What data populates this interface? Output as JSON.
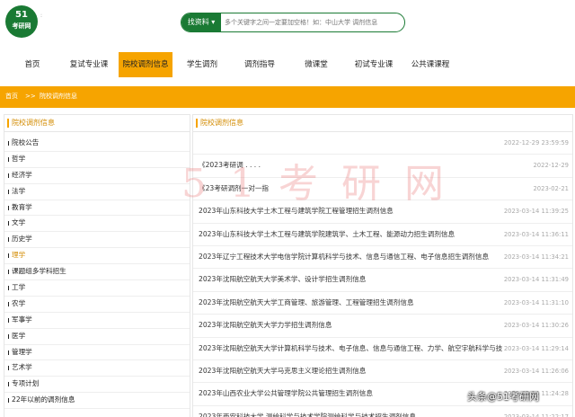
{
  "logo": {
    "number": "51",
    "text": "考研网",
    "colon": ":"
  },
  "search": {
    "button_label": "找资料",
    "placeholder": "多个关键字之间一定要加空格！如：中山大学 调剂信息"
  },
  "nav": {
    "items": [
      "首页",
      "复试专业课",
      "院校调剂信息",
      "学生调剂",
      "调剂指导",
      "微课堂",
      "初试专业课",
      "公共课课程"
    ]
  },
  "breadcrumb": {
    "home": "首页",
    "sep": ">>",
    "current": "院校调剂信息"
  },
  "sidebar": {
    "title": "院校调剂信息",
    "items": [
      "院校公告",
      "哲学",
      "经济学",
      "法学",
      "教育学",
      "文学",
      "历史学",
      "理学",
      "课题组多学科招生",
      "工学",
      "农学",
      "军事学",
      "医学",
      "管理学",
      "艺术学",
      "专项计划",
      "22年以前的调剂信息"
    ]
  },
  "main": {
    "title": "院校调剂信息",
    "news": [
      {
        "title": "",
        "date": "2022-12-29 23:59:59"
      },
      {
        "title": "《2023考研调 .  .  .  .",
        "date": "2022-12-29"
      },
      {
        "title": "《23考研调剂一对一指",
        "date": "2023-02-21"
      },
      {
        "title": "2023年山东科技大学土木工程与建筑学院工程管理招生调剂信息",
        "date": "2023-03-14 11:39:25"
      },
      {
        "title": "2023年山东科技大学土木工程与建筑学院建筑学、土木工程、能源动力招生调剂信息",
        "date": "2023-03-14 11:36:11"
      },
      {
        "title": "2023年辽宁工程技术大学电信学院计算机科学与技术、信息与通信工程、电子信息招生调剂信息",
        "date": "2023-03-14 11:34:21"
      },
      {
        "title": "2023年沈阳航空航天大学美术学、设计学招生调剂信息",
        "date": "2023-03-14 11:31:49"
      },
      {
        "title": "2023年沈阳航空航天大学工商管理、旅游管理、工程管理招生调剂信息",
        "date": "2023-03-14 11:31:10"
      },
      {
        "title": "2023年沈阳航空航天大学力学招生调剂信息",
        "date": "2023-03-14 11:30:26"
      },
      {
        "title": "2023年沈阳航空航天大学计算机科学与技术、电子信息、信息与通信工程、力学、航空宇航科学与技术、交通运输",
        "date": "2023-03-14 11:29:14"
      },
      {
        "title": "2023年沈阳航空航天大学马克思主义理论招生调剂信息",
        "date": "2023-03-14 11:26:06"
      },
      {
        "title": "2023年山西农业大学公共管理学院公共管理招生调剂信息",
        "date": "2023-03-14 11:24:28"
      },
      {
        "title": "2023年西安科技大学 测绘科学与技术学院测绘科学与技术招生调剂信息",
        "date": "2023-03-14 11:22:17"
      }
    ]
  },
  "watermark": "51考研网",
  "credit": "头条@51考研网"
}
